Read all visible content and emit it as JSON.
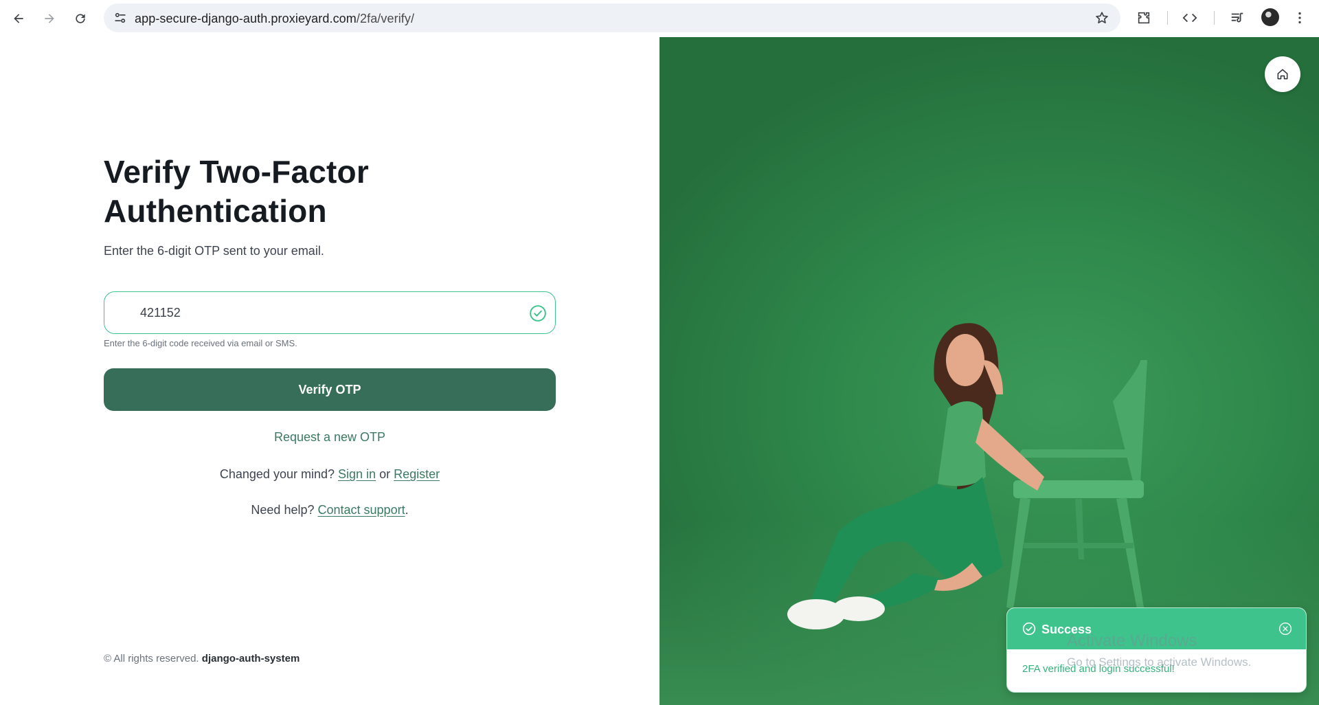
{
  "browser": {
    "url_host": "app-secure-django-auth.proxieyard.com",
    "url_path": "/2fa/verify/",
    "icons": {
      "back": "arrow-left-icon",
      "forward": "arrow-right-icon",
      "reload": "reload-icon",
      "site_info": "tune-icon",
      "bookmark": "star-icon",
      "extensions": "puzzle-icon",
      "devtools": "code-icon",
      "media": "media-queue-icon",
      "menu": "kebab-menu-icon"
    }
  },
  "form": {
    "title": "Verify Two-Factor Authentication",
    "subtitle": "Enter the 6-digit OTP sent to your email.",
    "otp_value": "421152",
    "hint": "Enter the 6-digit code received via email or SMS.",
    "verify_label": "Verify OTP",
    "request_new": "Request a new OTP",
    "changed_mind_prefix": "Changed your mind?",
    "sign_in": "Sign in",
    "or": "or",
    "register": "Register",
    "help_prefix": "Need help?",
    "contact_support": "Contact support",
    "help_suffix": "."
  },
  "footer": {
    "rights": "© All rights reserved.",
    "brand": "django-auth-system"
  },
  "toast": {
    "title": "Success",
    "message": "2FA verified and login successful!"
  },
  "os_watermark": {
    "line1": "Activate Windows",
    "line2": "Go to Settings to activate Windows."
  },
  "colors": {
    "accent": "#3fc38c",
    "button": "#366e5a",
    "link": "#3a7a62",
    "hero_bg": "#2f8a4c"
  }
}
